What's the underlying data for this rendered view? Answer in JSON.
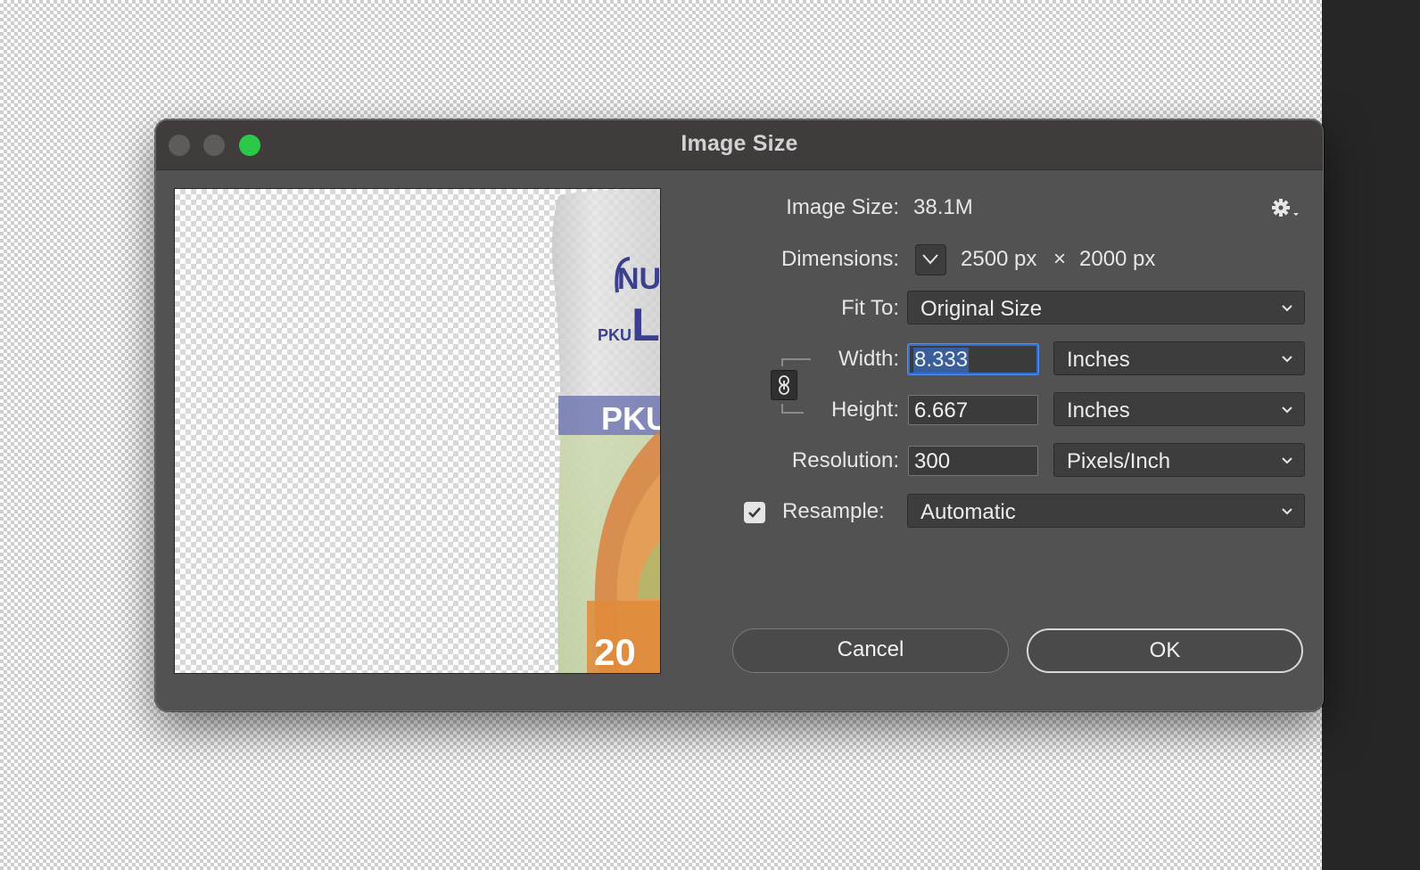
{
  "dialog": {
    "title": "Image Size"
  },
  "preview": {
    "product_text_top": "NU",
    "product_text_pku_small": "PKU",
    "product_text_big": "L",
    "product_band_text": "PKU",
    "product_number": "20"
  },
  "info": {
    "image_size_label": "Image Size:",
    "image_size_value": "38.1M",
    "dimensions_label": "Dimensions:",
    "dimensions_width": "2500 px",
    "dimensions_times": "×",
    "dimensions_height": "2000 px",
    "settings_icon": "gear-icon"
  },
  "fit_to": {
    "label": "Fit To:",
    "value": "Original Size"
  },
  "width": {
    "label": "Width:",
    "value": "8.333",
    "unit": "Inches"
  },
  "height": {
    "label": "Height:",
    "value": "6.667",
    "unit": "Inches"
  },
  "resolution": {
    "label": "Resolution:",
    "value": "300",
    "unit": "Pixels/Inch"
  },
  "resample": {
    "label": "Resample:",
    "checked": true,
    "value": "Automatic"
  },
  "buttons": {
    "cancel": "Cancel",
    "ok": "OK"
  },
  "colors": {
    "accent": "#2f6fd6",
    "maximize_green": "#2cc84a",
    "dialog_bg": "#525252"
  }
}
